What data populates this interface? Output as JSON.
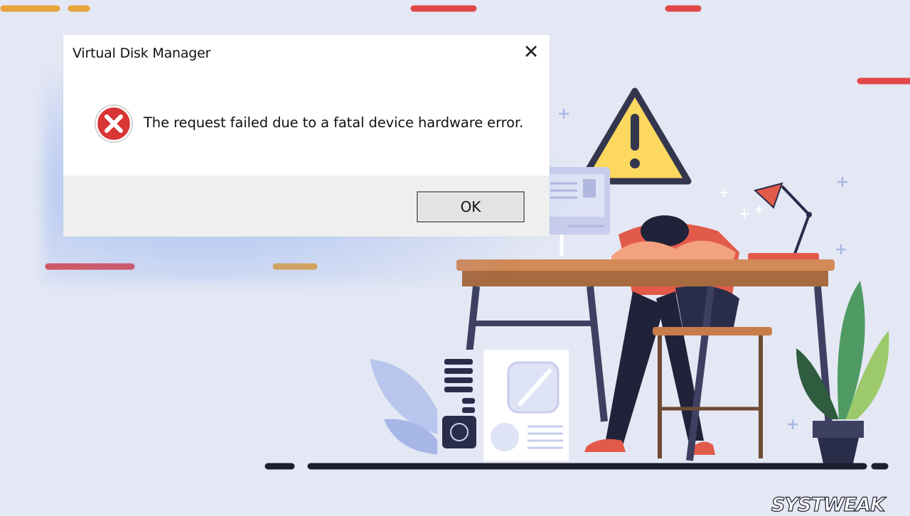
{
  "dialog": {
    "title": "Virtual Disk Manager",
    "close_glyph": "✕",
    "icon": "error-icon",
    "message": "The request failed due to a fatal device hardware error.",
    "ok_label": "OK"
  },
  "brand": {
    "logo_text": "SYSTWEAK"
  },
  "colors": {
    "background": "#e4e8f4",
    "accent_red": "#e04848",
    "accent_orange": "#e8a33a",
    "warning_yellow": "#fcd860",
    "navy": "#2a2d4a"
  }
}
